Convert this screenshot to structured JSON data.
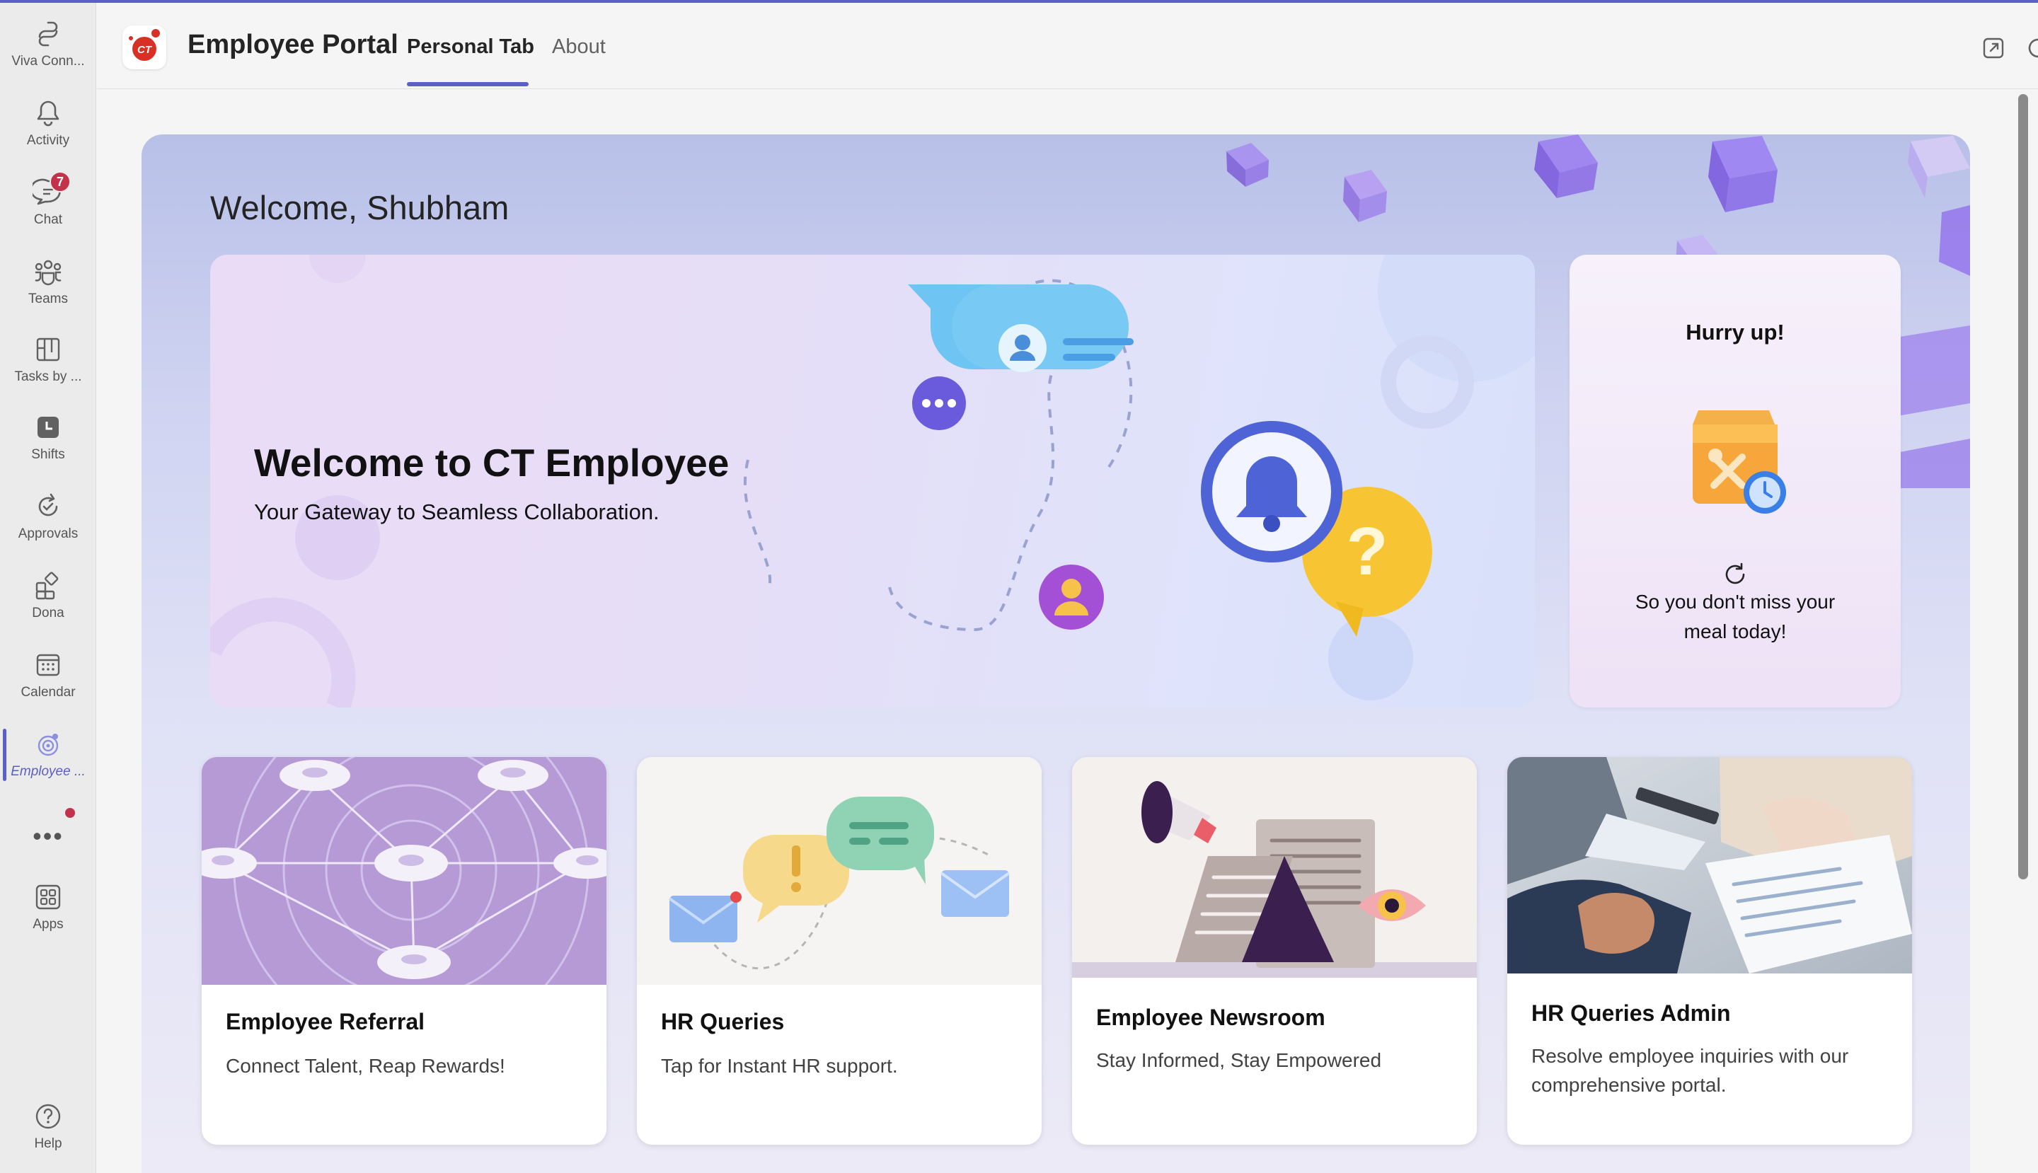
{
  "rail": {
    "items": [
      {
        "label": "Viva Conn...",
        "icon": "viva-connections-icon"
      },
      {
        "label": "Activity",
        "icon": "bell-icon"
      },
      {
        "label": "Chat",
        "icon": "chat-icon",
        "badge": "7"
      },
      {
        "label": "Teams",
        "icon": "teams-icon"
      },
      {
        "label": "Tasks by ...",
        "icon": "tasks-icon"
      },
      {
        "label": "Shifts",
        "icon": "shifts-icon"
      },
      {
        "label": "Approvals",
        "icon": "approvals-icon"
      },
      {
        "label": "Dona",
        "icon": "apps-grid-icon"
      },
      {
        "label": "Calendar",
        "icon": "calendar-icon"
      },
      {
        "label": "Employee ...",
        "icon": "employee-portal-icon",
        "active": true
      },
      {
        "label": "Apps",
        "icon": "apps-icon"
      },
      {
        "label": "Help",
        "icon": "help-icon"
      }
    ],
    "more": "•••"
  },
  "header": {
    "title": "Employee Portal",
    "logo_text": "CT",
    "tabs": [
      {
        "label": "Personal Tab",
        "active": true
      },
      {
        "label": "About",
        "active": false
      }
    ],
    "icons": [
      "popout-icon",
      "refresh-icon",
      "globe-icon"
    ]
  },
  "hero": {
    "greeting": "Welcome, Shubham",
    "banner": {
      "title": "Welcome to CT Employee",
      "subtitle": "Your Gateway to Seamless Collaboration."
    },
    "side_card": {
      "title": "Hurry up!",
      "text": "So you don't miss your meal today!"
    }
  },
  "cards": [
    {
      "title": "Employee Referral",
      "description": "Connect Talent, Reap Rewards!"
    },
    {
      "title": "HR Queries",
      "description": "Tap for Instant HR support."
    },
    {
      "title": "Employee Newsroom",
      "description": "Stay Informed, Stay Empowered"
    },
    {
      "title": "HR Queries Admin",
      "description": "Resolve employee inquiries with our comprehensive portal."
    }
  ],
  "colors": {
    "accent": "#5b5fc7",
    "badge": "#c4314b",
    "logo_red": "#d93025"
  }
}
